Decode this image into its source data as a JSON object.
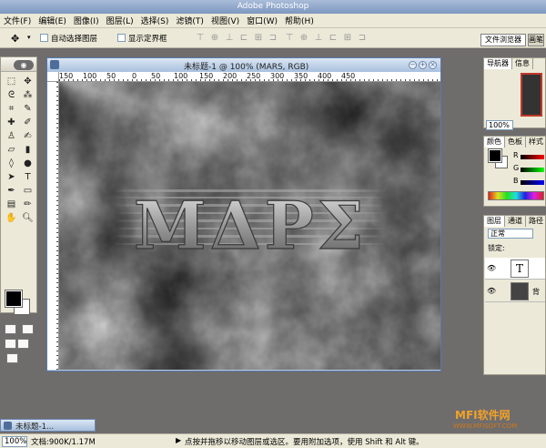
{
  "app": {
    "title": "Adobe Photoshop"
  },
  "menu": {
    "items": [
      "文件(F)",
      "编辑(E)",
      "图像(I)",
      "图层(L)",
      "选择(S)",
      "滤镜(T)",
      "视图(V)",
      "窗口(W)",
      "帮助(H)"
    ]
  },
  "options": {
    "auto_select_label": "自动选择图层",
    "show_bounds_label": "显示定界框",
    "file_browser_tab": "文件浏览器",
    "brushes_tab": "画笔"
  },
  "toolbox": {
    "tools": [
      "move-tool",
      "lasso-tool",
      "crop-tool",
      "brush-tool",
      "stamp-tool",
      "eraser-tool",
      "blur-tool",
      "pen-tool",
      "type-tool",
      "hand-tool",
      "zoom-tool"
    ]
  },
  "document": {
    "title": "未标题-1 @ 100% (MARS, RGB)",
    "ruler_ticks": [
      "150",
      "100",
      "50",
      "0",
      "50",
      "100",
      "150",
      "200",
      "250",
      "300",
      "350",
      "400",
      "450"
    ],
    "text_content": "ΜΔΡΣ"
  },
  "minimized_doc": {
    "title": "未标题-1..."
  },
  "status": {
    "zoom": "100%",
    "doc_size": "文档:900K/1.17M",
    "hint": "点按并拖移以移动图层或选区。要用附加选项，使用 Shift 和 Alt 键。"
  },
  "navigator": {
    "tabs": [
      "导航器",
      "信息"
    ],
    "zoom": "100%"
  },
  "color_panel": {
    "tabs": [
      "颜色",
      "色板",
      "样式"
    ],
    "sliders": [
      "R",
      "G",
      "B"
    ]
  },
  "layers_panel": {
    "tabs": [
      "图层",
      "通道",
      "路径"
    ],
    "blend_mode": "正常",
    "lock_label": "锁定:",
    "layers": [
      {
        "name": "",
        "thumb": "T"
      },
      {
        "name": "背",
        "thumb": ""
      }
    ]
  },
  "watermark": {
    "text": "MFI软件网",
    "sub": "WWW.MFISOFT.COM"
  }
}
